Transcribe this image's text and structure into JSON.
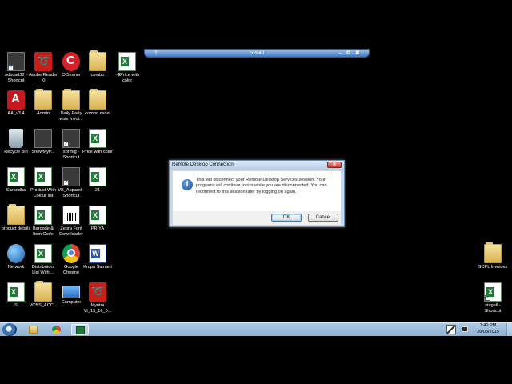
{
  "remote_bar": {
    "title": "com40",
    "pin": "†",
    "minimize": "–",
    "restore": "⧉",
    "close": "✖"
  },
  "dialog": {
    "title": "Remote Desktop Connection",
    "close_glyph": "✕",
    "icon_glyph": "i",
    "message": "This will disconnect your Remote Desktop Services session. Your programs will continue to run while you are disconnected. You can reconnect to this session later by logging on again.",
    "ok_label": "OK",
    "cancel_label": "Cancel"
  },
  "desktop_icons": [
    {
      "label": "odbcad32 - Shortcut",
      "icon": "generic-app-icon",
      "shortcut": true
    },
    {
      "label": "Adobe Reader XI",
      "icon": "pdf-icon",
      "shortcut": false
    },
    {
      "label": "CCleaner",
      "icon": "ccleaner-icon",
      "shortcut": false
    },
    {
      "label": "combo",
      "icon": "folder-icon",
      "shortcut": false
    },
    {
      "label": "~$Price with color",
      "icon": "excel-icon",
      "shortcut": false
    },
    {
      "label": "AA_v3.4",
      "icon": "autocad-icon",
      "shortcut": false
    },
    {
      "label": "Admin",
      "icon": "folder-icon",
      "shortcut": false
    },
    {
      "label": "Daily Party wise Invoi...",
      "icon": "folder-icon",
      "shortcut": false
    },
    {
      "label": "combo excel",
      "icon": "folder-icon",
      "shortcut": false
    },
    {
      "label": "Recycle Bin",
      "icon": "recycle-bin-icon",
      "shortcut": false
    },
    {
      "label": "ShowMyP...",
      "icon": "generic-app-icon",
      "shortcut": false
    },
    {
      "label": "sprmig - Shortcut",
      "icon": "generic-app-icon",
      "shortcut": true
    },
    {
      "label": "Price with color",
      "icon": "excel-icon",
      "shortcut": false
    },
    {
      "label": "Sarandha",
      "icon": "excel-icon",
      "shortcut": false
    },
    {
      "label": "Product With Colour list",
      "icon": "excel-icon",
      "shortcut": false
    },
    {
      "label": "VB_Apparel - Shortcut",
      "icon": "generic-app-icon",
      "shortcut": true
    },
    {
      "label": "21",
      "icon": "excel-icon",
      "shortcut": false
    },
    {
      "label": "product details",
      "icon": "folder-icon",
      "shortcut": false
    },
    {
      "label": "Barcode & Item Code",
      "icon": "excel-icon",
      "shortcut": false
    },
    {
      "label": "Zebra Font Downloader",
      "icon": "zebra-icon",
      "shortcut": false
    },
    {
      "label": "PRIYA",
      "icon": "excel-icon",
      "shortcut": false
    },
    {
      "label": "Network",
      "icon": "network-icon",
      "shortcut": false
    },
    {
      "label": "Distributors List With ...",
      "icon": "excel-icon",
      "shortcut": false
    },
    {
      "label": "Google Chrome",
      "icon": "chrome-icon",
      "shortcut": false
    },
    {
      "label": "Krupa Samant",
      "icon": "word-icon",
      "shortcut": false
    },
    {
      "label": "S",
      "icon": "excel-icon",
      "shortcut": false
    },
    {
      "label": "VCBS_ACC...",
      "icon": "folder-icon",
      "shortcut": false
    },
    {
      "label": "Computer",
      "icon": "computer-icon",
      "shortcut": false
    },
    {
      "label": "Myntra VI_15_16_0...",
      "icon": "pdf-icon",
      "shortcut": false
    },
    {
      "label": "SCPL Invoices",
      "icon": "folder-icon",
      "shortcut": false
    },
    {
      "label": "stagell - Shortcut",
      "icon": "excel-icon",
      "shortcut": true
    }
  ],
  "taskbar": {
    "pinned": [
      {
        "name": "windows-explorer-icon"
      },
      {
        "name": "chrome-icon"
      },
      {
        "name": "excel-icon"
      }
    ],
    "clock_time": "1:40 PM",
    "clock_date": "26/08/2015"
  },
  "colors": {
    "desktop": "#000000",
    "taskbar": "#9dbfde",
    "dialog_frame": "#c9d9ea",
    "connection_bar": "#3f78c2"
  }
}
